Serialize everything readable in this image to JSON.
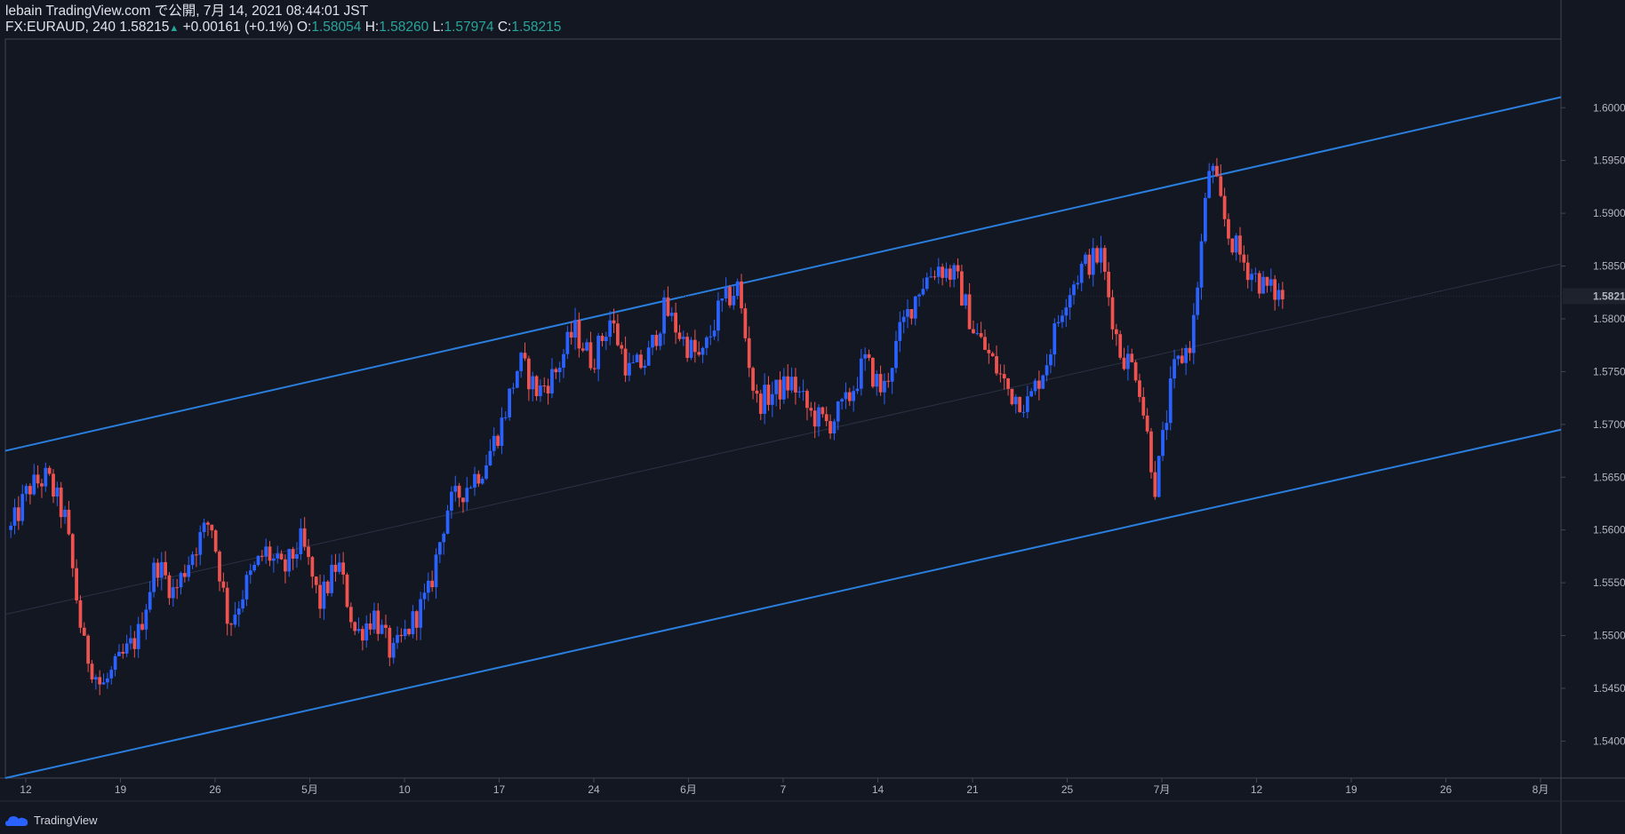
{
  "header": {
    "line1": "lebain TradingView.com で公開, 7月 14, 2021 08:44:01 JST",
    "symbol": "FX:EURAUD, 240",
    "price": "1.58215",
    "change": "+0.00161 (+0.1%)",
    "o_label": "O:",
    "o_value": "1.58054",
    "h_label": "H:",
    "h_value": "1.58260",
    "l_label": "L:",
    "l_value": "1.57974",
    "c_label": "C:",
    "c_value": "1.58215"
  },
  "footer": {
    "brand": "TradingView"
  },
  "colors": {
    "background": "#131722",
    "up_candle": "#2962ff",
    "down_candle": "#ef5350",
    "channel_line": "#2a7fde",
    "mid_line": "#2b3245",
    "axis_text": "#b2b5be",
    "last_price_bg": "#1e222d"
  },
  "chart_data": {
    "type": "candlestick",
    "x_ticks": [
      "12",
      "19",
      "26",
      "5月",
      "10",
      "17",
      "24",
      "6月",
      "7",
      "14",
      "21",
      "25",
      "7月",
      "12",
      "19",
      "26",
      "8月"
    ],
    "y_ticks": [
      "1.60000",
      "1.59500",
      "1.59000",
      "1.58500",
      "1.58000",
      "1.57500",
      "1.57000",
      "1.56500",
      "1.56000",
      "1.55500",
      "1.55000",
      "1.54500",
      "1.54000"
    ],
    "ylim": [
      1.5365,
      1.6065
    ],
    "last_price": "1.58215",
    "channel": {
      "upper": [
        [
          "12 (start)",
          1.5675
        ],
        [
          "8月 (end)",
          1.601
        ]
      ],
      "lower": [
        [
          "12 (start)",
          1.5365
        ],
        [
          "8月 (end)",
          1.5695
        ]
      ],
      "middle": [
        [
          "12 (start)",
          1.552
        ],
        [
          "8月 (end)",
          1.5852
        ]
      ]
    },
    "close_path": [
      [
        "12",
        1.56
      ],
      [
        "13",
        1.564
      ],
      [
        "14",
        1.565
      ],
      [
        "15",
        1.561
      ],
      [
        "16",
        1.549
      ],
      [
        "17",
        1.545
      ],
      [
        "19",
        1.5475
      ],
      [
        "20",
        1.55
      ],
      [
        "21",
        1.557
      ],
      [
        "22",
        1.554
      ],
      [
        "23",
        1.558
      ],
      [
        "26",
        1.561
      ],
      [
        "27",
        1.551
      ],
      [
        "28",
        1.555
      ],
      [
        "29",
        1.558
      ],
      [
        "30",
        1.556
      ],
      [
        "5月",
        1.559
      ],
      [
        "4",
        1.553
      ],
      [
        "5",
        1.557
      ],
      [
        "6",
        1.55
      ],
      [
        "7",
        1.552
      ],
      [
        "10",
        1.548
      ],
      [
        "11",
        1.551
      ],
      [
        "12",
        1.554
      ],
      [
        "13",
        1.562
      ],
      [
        "14",
        1.564
      ],
      [
        "17",
        1.566
      ],
      [
        "18",
        1.57
      ],
      [
        "19",
        1.576
      ],
      [
        "20",
        1.573
      ],
      [
        "21",
        1.575
      ],
      [
        "24",
        1.579
      ],
      [
        "25",
        1.576
      ],
      [
        "26",
        1.58
      ],
      [
        "27",
        1.575
      ],
      [
        "28",
        1.576
      ],
      [
        "31",
        1.581
      ],
      [
        "6月",
        1.578
      ],
      [
        "2",
        1.576
      ],
      [
        "3",
        1.581
      ],
      [
        "4",
        1.583
      ],
      [
        "7",
        1.572
      ],
      [
        "8",
        1.573
      ],
      [
        "9",
        1.574
      ],
      [
        "10",
        1.571
      ],
      [
        "11",
        1.57
      ],
      [
        "14",
        1.572
      ],
      [
        "15",
        1.576
      ],
      [
        "16",
        1.573
      ],
      [
        "17",
        1.579
      ],
      [
        "18",
        1.583
      ],
      [
        "21",
        1.585
      ],
      [
        "22",
        1.584
      ],
      [
        "23",
        1.579
      ],
      [
        "24",
        1.576
      ],
      [
        "25",
        1.573
      ],
      [
        "28",
        1.572
      ],
      [
        "29",
        1.576
      ],
      [
        "30",
        1.582
      ],
      [
        "7月",
        1.585
      ],
      [
        "2",
        1.586
      ],
      [
        "5",
        1.577
      ],
      [
        "6",
        1.575
      ],
      [
        "7",
        1.564
      ],
      [
        "8",
        1.575
      ],
      [
        "9",
        1.578
      ],
      [
        "12",
        1.595
      ],
      [
        "13",
        1.588
      ],
      [
        "14",
        1.585
      ],
      [
        "15",
        1.583
      ],
      [
        "16",
        1.5821
      ]
    ]
  }
}
